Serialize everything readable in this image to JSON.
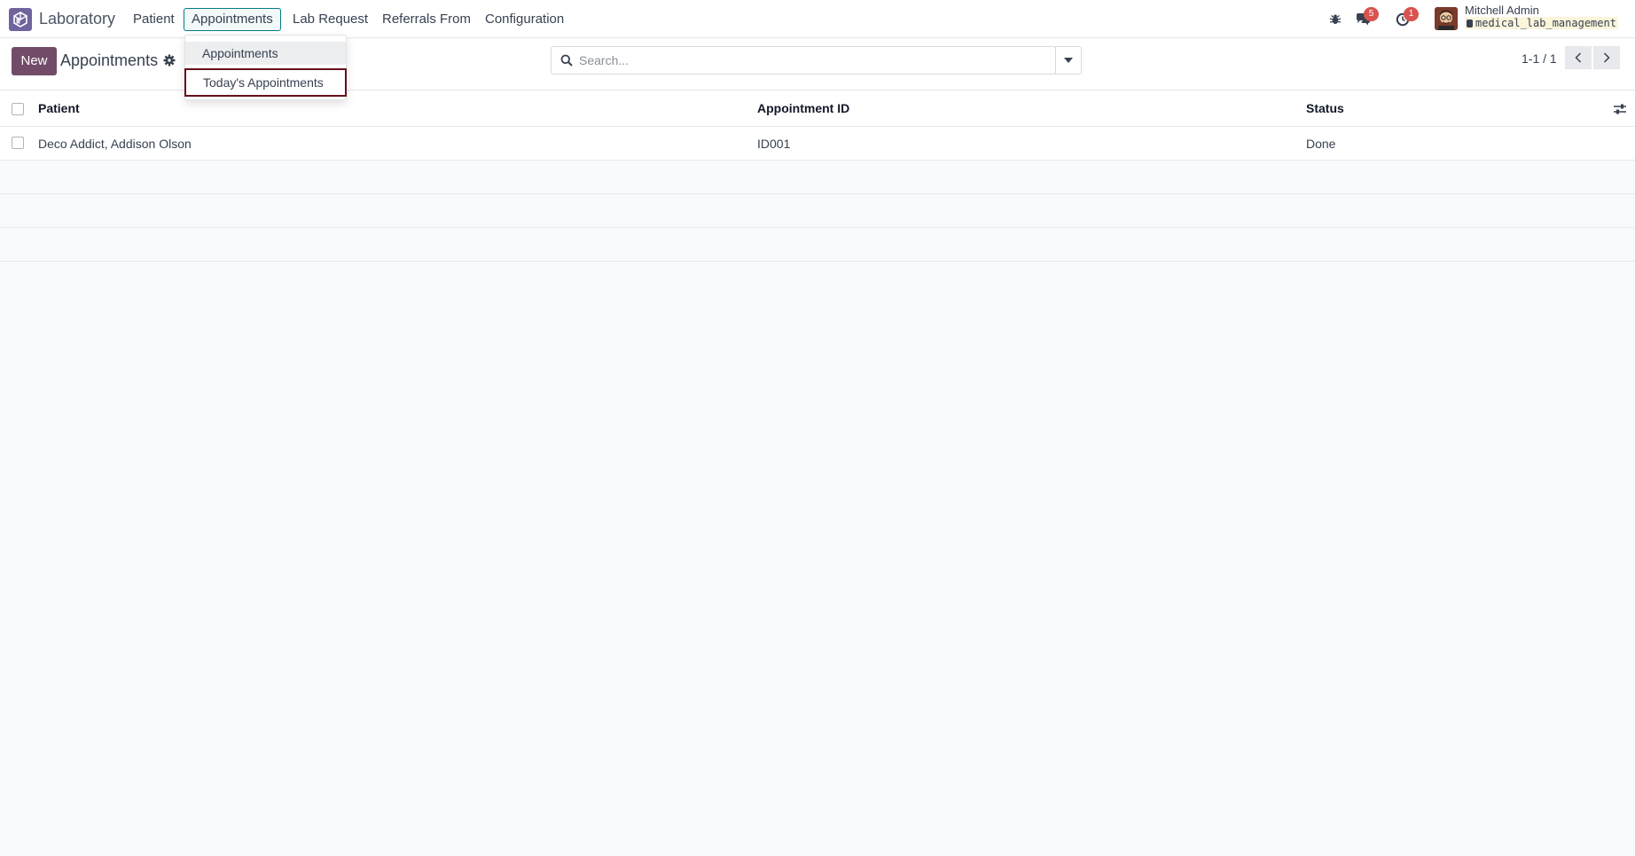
{
  "navbar": {
    "app_name": "Laboratory",
    "menus": [
      "Patient",
      "Appointments",
      "Lab Request",
      "Referrals From",
      "Configuration"
    ],
    "active_menu": "Appointments",
    "messages_count": "5",
    "activities_count": "1",
    "user_name": "Mitchell Admin",
    "database": "medical_lab_management"
  },
  "dropdown": {
    "items": [
      "Appointments",
      "Today's Appointments"
    ]
  },
  "control": {
    "new_label": "New",
    "title": "Appointments",
    "search_placeholder": "Search...",
    "pager": "1-1 / 1"
  },
  "list": {
    "columns": [
      "Patient",
      "Appointment ID",
      "Status"
    ],
    "rows": [
      {
        "patient": "Deco Addict, Addison Olson",
        "appointment_id": "ID001",
        "status": "Done"
      }
    ]
  },
  "colors": {
    "brand": "#714b67",
    "accent": "#017e84",
    "badge": "#d9534f"
  }
}
